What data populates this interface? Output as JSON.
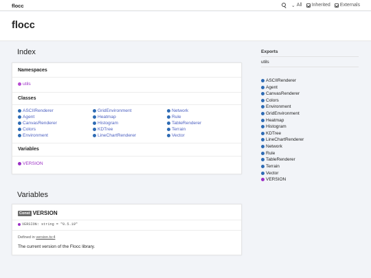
{
  "topbar": {
    "brand": "flocc",
    "filter_label": "All",
    "inherited_label": "Inherited",
    "externals_label": "Externals"
  },
  "header": {
    "title": "flocc"
  },
  "index": {
    "heading": "Index",
    "namespaces_title": "Namespaces",
    "namespaces": [
      "utils"
    ],
    "classes_title": "Classes",
    "classes_col1": [
      "ASCIIRenderer",
      "Agent",
      "CanvasRenderer",
      "Colors",
      "Environment"
    ],
    "classes_col2": [
      "GridEnvironment",
      "Heatmap",
      "Histogram",
      "KDTree",
      "LineChartRenderer"
    ],
    "classes_col3": [
      "Network",
      "Rule",
      "TableRenderer",
      "Terrain",
      "Vector"
    ],
    "variables_title": "Variables",
    "variables": [
      "VERSION"
    ]
  },
  "variables_section": {
    "heading": "Variables",
    "badge": "Const",
    "name": "VERSION",
    "signature": "VERSION: string = \"0.5.19\"",
    "defined_in_prefix": "Defined in",
    "defined_in_link": "version.ts:4",
    "description": "The current version of the Flocc library."
  },
  "sidebar": {
    "exports_label": "Exports",
    "current": "utils",
    "items": [
      "ASCIIRenderer",
      "Agent",
      "CanvasRenderer",
      "Colors",
      "Environment",
      "GridEnvironment",
      "Heatmap",
      "Histogram",
      "KDTree",
      "LineChartRenderer",
      "Network",
      "Rule",
      "TableRenderer",
      "Terrain",
      "Vector",
      "VERSION"
    ]
  },
  "colors": {
    "link": "#4b5fc0",
    "class_icon": "#2e6bb4",
    "variable_icon": "#9b2fc5",
    "namespace_icon": "#b84bd3"
  }
}
